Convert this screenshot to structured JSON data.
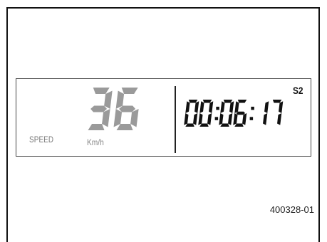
{
  "display": {
    "speed_label": "SPEED",
    "speed_value": "36",
    "speed_unit": "Km/h",
    "timer_value": "00:06:17",
    "screen_label": "S2"
  },
  "figure_id": "400328-01",
  "colors": {
    "speed_digits": "#9a9a9a",
    "timer_digits": "#111111",
    "labels": "#777777"
  }
}
